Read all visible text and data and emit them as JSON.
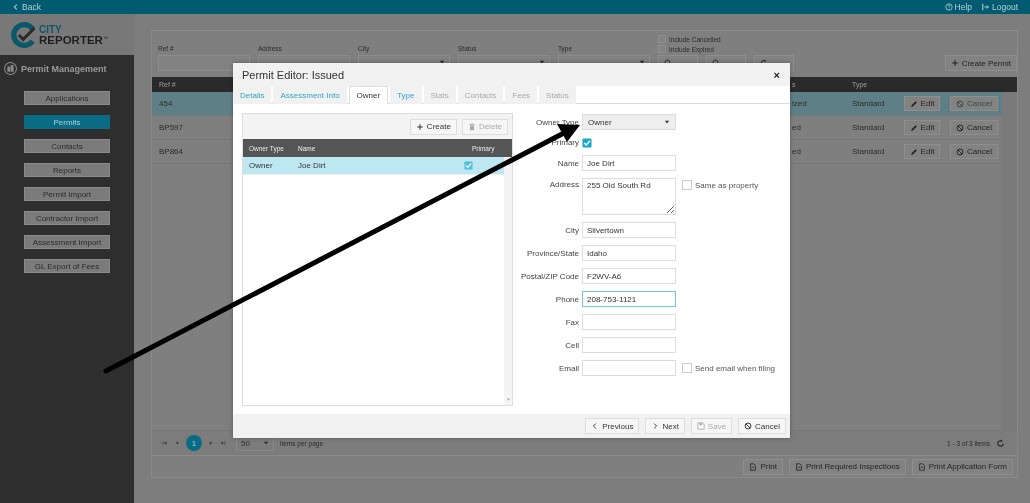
{
  "top_bar": {
    "back": "Back",
    "help": "Help",
    "logout": "Logout"
  },
  "logo": {
    "line_1": "CITY",
    "line_2": "REPORTER",
    "mark": "™"
  },
  "sidebar": {
    "title": "Permit Management",
    "items": [
      {
        "label": "Applications",
        "selected": false
      },
      {
        "label": "Permits",
        "selected": true
      },
      {
        "label": "Contacts",
        "selected": false
      },
      {
        "label": "Reports",
        "selected": false
      },
      {
        "label": "Permit Import",
        "selected": false
      },
      {
        "label": "Contractor Import",
        "selected": false
      },
      {
        "label": "Assessment Import",
        "selected": false
      },
      {
        "label": "GL Export of Fees",
        "selected": false
      }
    ]
  },
  "filters": {
    "fields": [
      {
        "label": "Ref #",
        "kind": "text"
      },
      {
        "label": "Address",
        "kind": "text"
      },
      {
        "label": "City",
        "kind": "select"
      },
      {
        "label": "Status",
        "kind": "select"
      },
      {
        "label": "Type",
        "kind": "select"
      }
    ],
    "checkboxes": [
      {
        "label": "Include Cancelled",
        "checked": false
      },
      {
        "label": "Include Expired",
        "checked": false
      }
    ],
    "buttons": [
      {
        "kind": "search"
      },
      {
        "kind": "search"
      },
      {
        "kind": "reset"
      }
    ],
    "create": "Create Permit"
  },
  "permits_table": {
    "columns": [
      "Ref #",
      "s",
      "Type"
    ],
    "rows": [
      {
        "ref": "454",
        "status": "ized",
        "type": "Standard",
        "edit": "Edit",
        "cancel": "Cancel",
        "cancel_disabled": true,
        "selected": true
      },
      {
        "ref": "BP597",
        "status": "ed",
        "type": "Standard",
        "edit": "Edit",
        "cancel": "Cancel",
        "cancel_disabled": false,
        "selected": false
      },
      {
        "ref": "BP864",
        "status": "ed",
        "type": "Standard",
        "edit": "Edit",
        "cancel": "Cancel",
        "cancel_disabled": false,
        "selected": false
      }
    ]
  },
  "pager": {
    "page": "1",
    "page_size": "50",
    "per_page_label": "items per page",
    "summary": "1 - 3 of 3 items"
  },
  "print_buttons": [
    "Print",
    "Print Required Inspections",
    "Print Application Form"
  ],
  "dialog": {
    "title": "Permit Editor: Issued",
    "close": "×",
    "tabs": [
      {
        "label": "Details",
        "selected": false,
        "disabled": false
      },
      {
        "label": "Assessment Info",
        "selected": false,
        "disabled": false
      },
      {
        "label": "Owner",
        "selected": true,
        "disabled": false
      },
      {
        "label": "Type",
        "selected": false,
        "disabled": false
      },
      {
        "label": "Stats",
        "selected": false,
        "disabled": true
      },
      {
        "label": "Contacts",
        "selected": false,
        "disabled": true
      },
      {
        "label": "Fees",
        "selected": false,
        "disabled": true
      },
      {
        "label": "Status",
        "selected": false,
        "disabled": true
      }
    ],
    "owners": {
      "create": "Create",
      "delete": "Delete",
      "delete_disabled": true,
      "columns": [
        "Owner Type",
        "Name",
        "Primary"
      ],
      "rows": [
        {
          "owner_type": "Owner",
          "name": "Joe Dirt",
          "primary": true,
          "selected": true
        }
      ]
    },
    "form": {
      "owner_type": {
        "label": "Owner Type",
        "value": "Owner"
      },
      "primary": {
        "label": "Primary",
        "checked": true
      },
      "fields": [
        {
          "label": "Name",
          "value": "Joe Dirt",
          "kind": "input",
          "focused": false
        },
        {
          "label": "Address",
          "value": "255 Old South Rd",
          "kind": "textarea",
          "focused": false,
          "option": {
            "label": "Same as property",
            "checked": false
          }
        },
        {
          "label": "City",
          "value": "Silvertown",
          "kind": "input",
          "focused": false
        },
        {
          "label": "Province/State",
          "value": "Idaho",
          "kind": "input",
          "focused": false
        },
        {
          "label": "Postal/ZIP Code",
          "value": "F2WV-A6",
          "kind": "input",
          "focused": false
        },
        {
          "label": "Phone",
          "value": "208-753-1121",
          "kind": "input",
          "focused": true
        },
        {
          "label": "Fax",
          "kind": "input",
          "focused": false
        },
        {
          "label": "Cell",
          "kind": "input",
          "focused": false
        },
        {
          "label": "Email",
          "kind": "input",
          "focused": false,
          "option": {
            "label": "Send email when filing",
            "checked": false
          }
        }
      ]
    },
    "footer": [
      {
        "label": "Previous",
        "kind": "previous",
        "disabled": false
      },
      {
        "label": "Next",
        "kind": "next",
        "disabled": false
      },
      {
        "label": "Save",
        "kind": "save",
        "disabled": true
      },
      {
        "label": "Cancel",
        "kind": "cancel",
        "disabled": false
      }
    ]
  }
}
